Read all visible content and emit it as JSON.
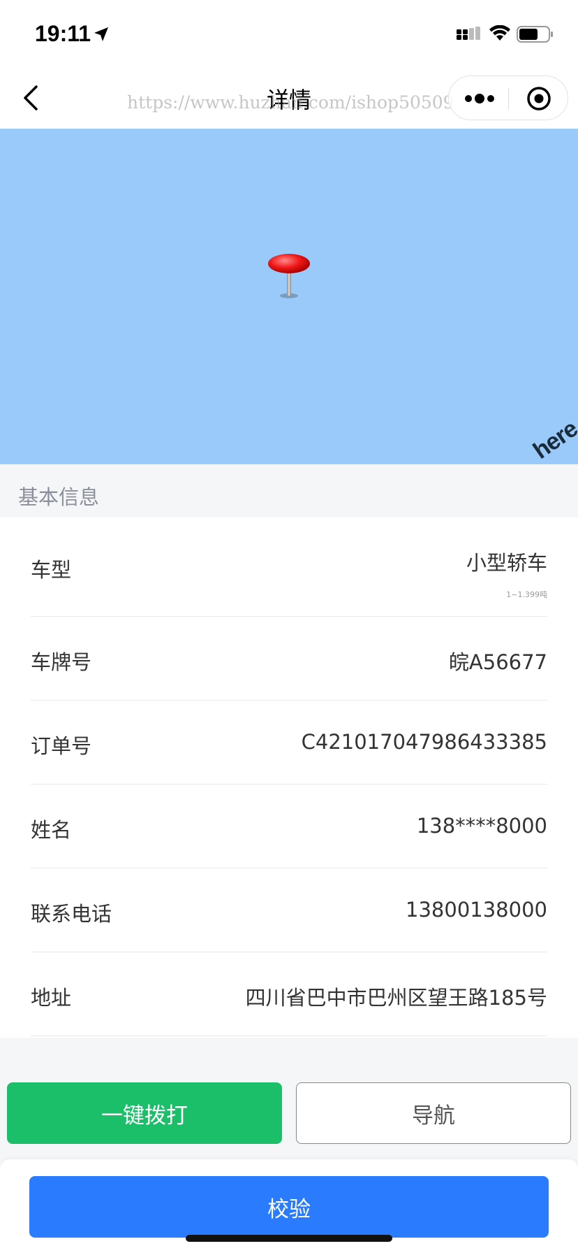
{
  "status_bar": {
    "time": "19:11",
    "icons": [
      "location-arrow-icon",
      "signal-icon",
      "wifi-icon",
      "battery-icon"
    ]
  },
  "nav": {
    "title": "详情",
    "watermark": "https://www.huzhan.com/ishop50509",
    "icons": [
      "back-chevron-icon",
      "more-dots-icon",
      "target-circle-icon"
    ]
  },
  "map": {
    "background_color": "#99caf9",
    "logo_text": "here",
    "icons": [
      "map-pin-icon"
    ]
  },
  "section": {
    "title": "基本信息"
  },
  "info": {
    "vehicle_type": {
      "label": "车型",
      "value": "小型轿车",
      "sub": "1~1.399吨"
    },
    "plate": {
      "label": "车牌号",
      "value": "皖A56677"
    },
    "order": {
      "label": "订单号",
      "value": "C421017047986433385"
    },
    "name": {
      "label": "姓名",
      "value": "138****8000"
    },
    "phone": {
      "label": "联系电话",
      "value": "13800138000"
    },
    "address": {
      "label": "地址",
      "value": "四川省巴中市巴州区望王路185号"
    }
  },
  "actions": {
    "call_label": "一键拨打",
    "navigate_label": "导航",
    "verify_label": "校验"
  },
  "colors": {
    "call": "#1cbf69",
    "verify": "#2b7bff",
    "map": "#99caf9"
  }
}
